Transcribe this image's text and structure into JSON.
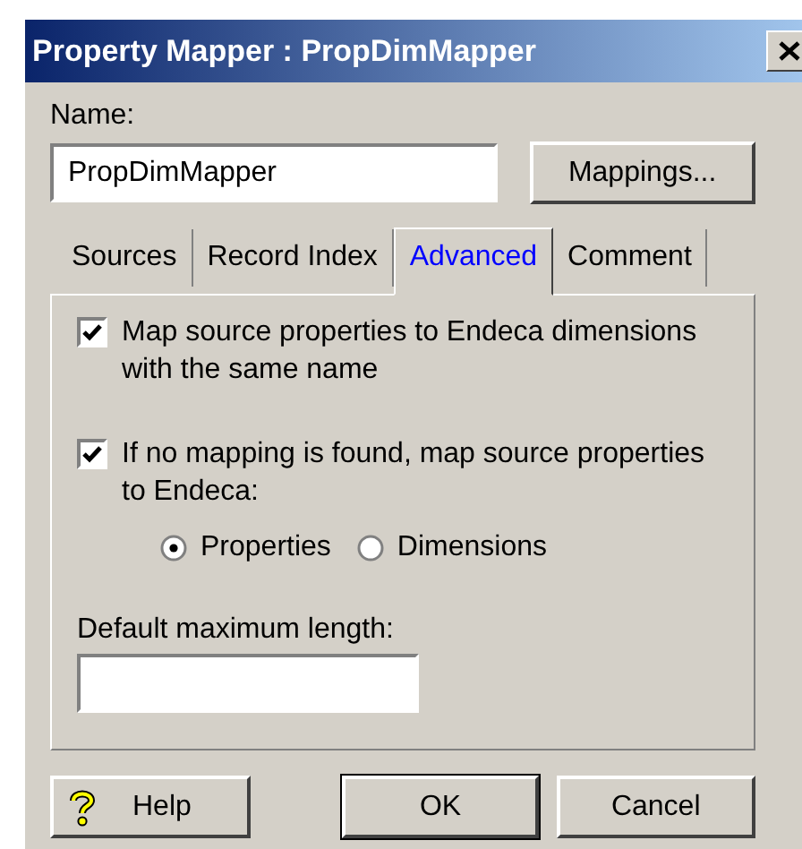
{
  "window": {
    "title": "Property Mapper : PropDimMapper"
  },
  "name_field": {
    "label": "Name:",
    "value": "PropDimMapper"
  },
  "mappings_button": "Mappings...",
  "tabs": [
    {
      "label": "Sources",
      "selected": false
    },
    {
      "label": "Record Index",
      "selected": false
    },
    {
      "label": "Advanced",
      "selected": true
    },
    {
      "label": "Comment",
      "selected": false
    }
  ],
  "options": [
    {
      "label": "Map source properties to Endeca dimensions with the same name",
      "checked": true
    },
    {
      "label": "If no mapping is found, map source properties to Endeca:",
      "checked": true
    }
  ],
  "radios": [
    {
      "label": "Properties",
      "selected": true
    },
    {
      "label": "Dimensions",
      "selected": false
    }
  ],
  "max_length": {
    "label": "Default maximum length:"
  },
  "buttons": [
    {
      "label": "Help",
      "kind": "help"
    },
    {
      "label": "OK",
      "kind": "default"
    },
    {
      "label": "Cancel",
      "kind": "plain"
    }
  ]
}
